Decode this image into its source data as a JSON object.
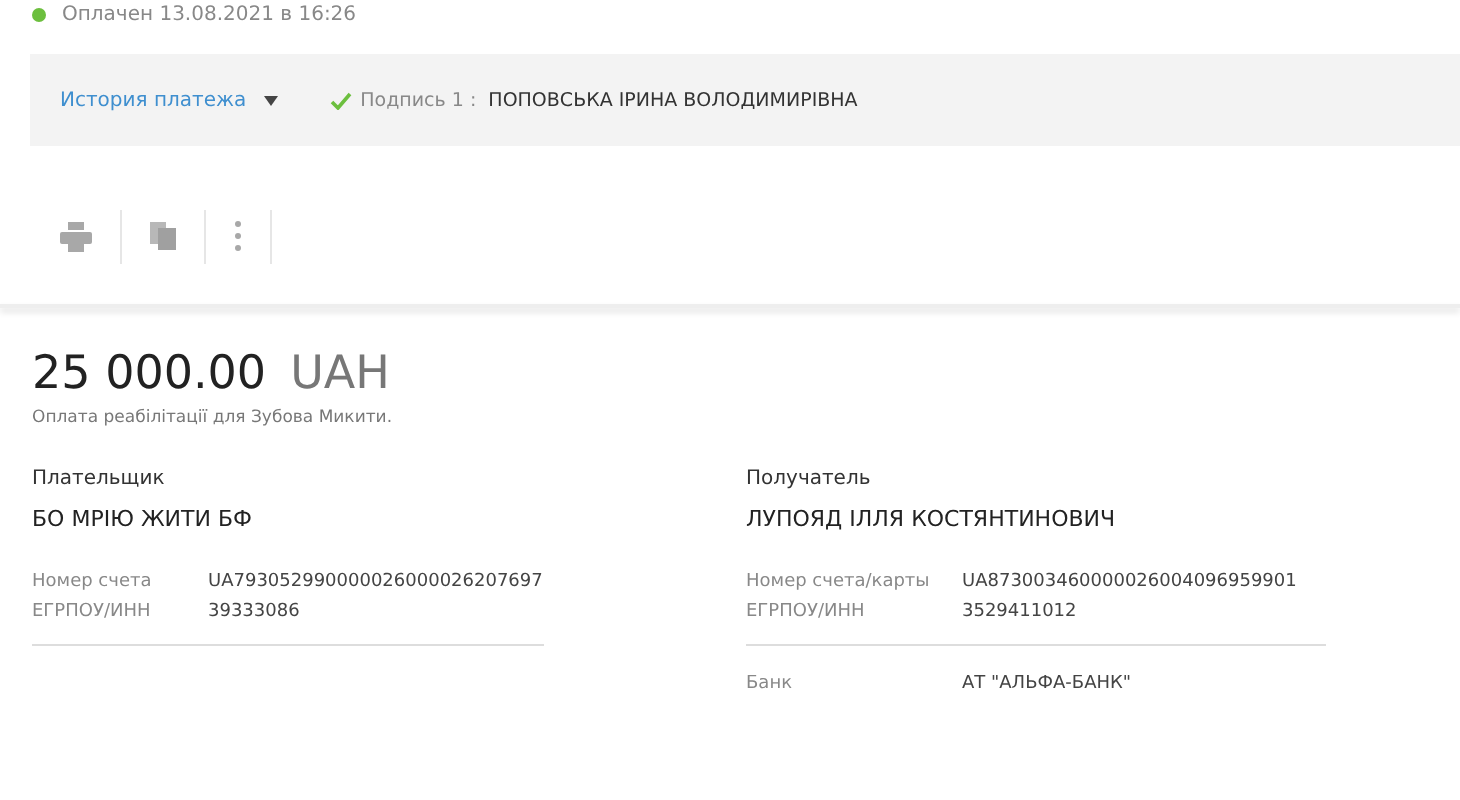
{
  "status": {
    "text": "Оплачен 13.08.2021 в 16:26",
    "color": "#6cbf3e"
  },
  "history_bar": {
    "history_link": "История платежа",
    "signature_label": "Подпись 1 :",
    "signer": "ПОПОВСЬКА ІРИНА ВОЛОДИМИРІВНА"
  },
  "amount": {
    "value": "25 000.00",
    "currency": "UAH"
  },
  "purpose": "Оплата реабілітації для Зубова Микити.",
  "parties": [
    {
      "heading": "Плательщик",
      "name": "БО МРІЮ ЖИТИ БФ",
      "fields": [
        {
          "label": "Номер счета",
          "value": "UA793052990000026000026207697"
        },
        {
          "label": "ЕГРПОУ/ИНН",
          "value": "39333086"
        }
      ]
    },
    {
      "heading": "Получатель",
      "name": "ЛУПОЯД ІЛЛЯ КОСТЯНТИНОВИЧ",
      "fields": [
        {
          "label": "Номер счета/карты",
          "value": "UA873003460000026004096959901"
        },
        {
          "label": "ЕГРПОУ/ИНН",
          "value": "3529411012"
        }
      ],
      "extra": [
        {
          "label": "Банк",
          "value": "АТ \"АЛЬФА-БАНК\""
        }
      ]
    }
  ]
}
